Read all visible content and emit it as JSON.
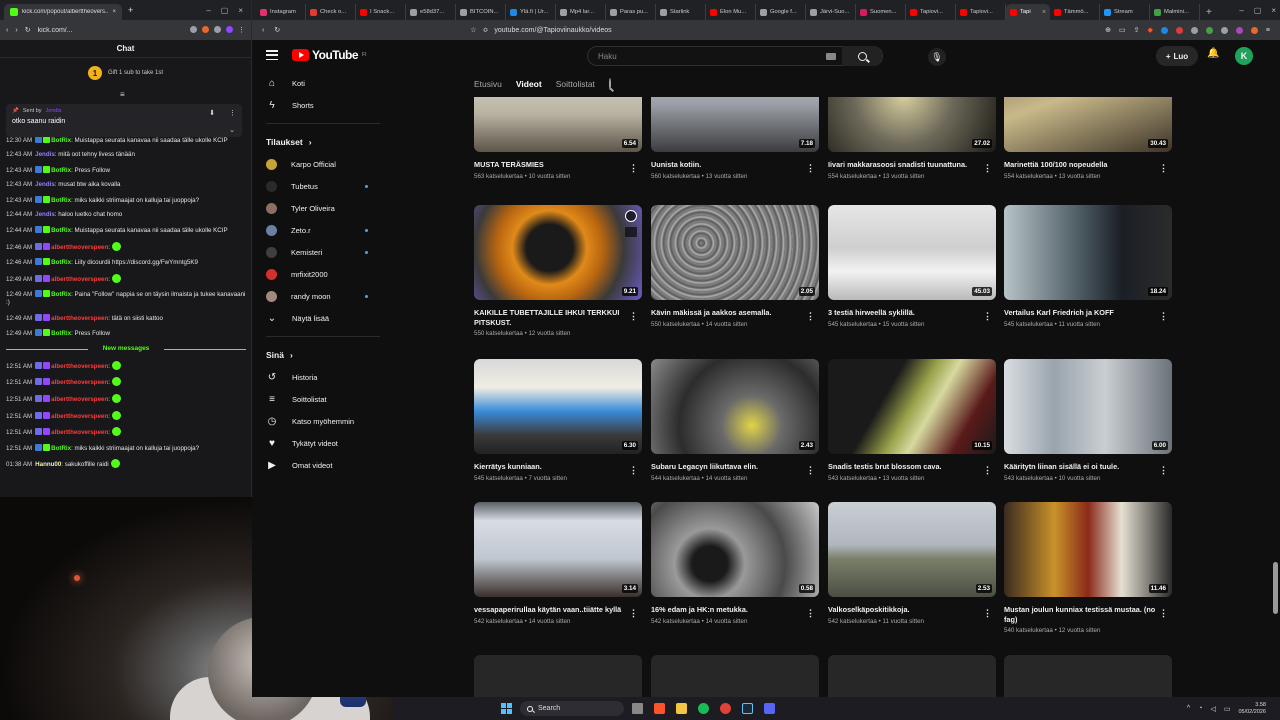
{
  "kick": {
    "tab_title": "kick.com/popout/alberttheovers...",
    "url": "kick.com/...",
    "chat_title": "Chat",
    "gift_text": "Gift 1 sub to take 1st",
    "gift_rank": "1",
    "pinned": {
      "sent_by_label": "Sent by",
      "sent_by_user": "Jendis",
      "message": "otko saanu raidin"
    },
    "new_messages_label": "New messages",
    "messages": [
      {
        "time": "12:30 AM",
        "badges": [
          "blue",
          "green"
        ],
        "user": "BotRix",
        "ucls": "u-botrix",
        "text": ": Muistappa seurata kanavaa nii saadaa tälle ukolle KCIP",
        "emote": false
      },
      {
        "time": "12:43 AM",
        "badges": [],
        "user": "Jendis",
        "ucls": "u-jendis",
        "text": ": mitä oot tehny livess tänään",
        "emote": false
      },
      {
        "time": "12:43 AM",
        "badges": [
          "blue",
          "green"
        ],
        "user": "BotRix",
        "ucls": "u-botrix",
        "text": ": Press Follow",
        "emote": false
      },
      {
        "time": "12:43 AM",
        "badges": [],
        "user": "Jendis",
        "ucls": "u-jendis",
        "text": ": musat btw aika kovalla",
        "emote": false
      },
      {
        "time": "12:43 AM",
        "badges": [
          "blue",
          "green"
        ],
        "user": "BotRix",
        "ucls": "u-botrix",
        "text": ": miks kaikki striimaajat on kalluja tai juoppoja?",
        "emote": false
      },
      {
        "time": "12:44 AM",
        "badges": [],
        "user": "Jendis",
        "ucls": "u-jendis",
        "text": ": haloo luetko chat homo",
        "emote": false
      },
      {
        "time": "12:44 AM",
        "badges": [
          "blue",
          "green"
        ],
        "user": "BotRix",
        "ucls": "u-botrix",
        "text": ": Muistappa seurata kanavaa nii saadaa tälle ukolle KCIP",
        "emote": false
      },
      {
        "time": "12:46 AM",
        "badges": [
          "mic",
          "purple"
        ],
        "user": "alberttheoverspeen",
        "ucls": "u-albert",
        "text": ":",
        "emote": true
      },
      {
        "time": "12:46 AM",
        "badges": [
          "blue",
          "green"
        ],
        "user": "BotRix",
        "ucls": "u-botrix",
        "text": ": Liity dicourdii https://discord.gg/FwYmntg5K9",
        "emote": false
      },
      {
        "time": "12:49 AM",
        "badges": [
          "mic",
          "purple"
        ],
        "user": "alberttheoverspeen",
        "ucls": "u-albert",
        "text": ":",
        "emote": true
      },
      {
        "time": "12:49 AM",
        "badges": [
          "blue",
          "green"
        ],
        "user": "BotRix",
        "ucls": "u-botrix",
        "text": ": Paina \"Follow\" nappia se on täysin ilmaista ja tukee kanavaani :)",
        "emote": false
      },
      {
        "time": "12:49 AM",
        "badges": [
          "mic",
          "purple"
        ],
        "user": "alberttheoverspeen",
        "ucls": "u-albert",
        "text": ": tätä on siisti kattoo",
        "emote": false
      },
      {
        "time": "12:49 AM",
        "badges": [
          "blue",
          "green"
        ],
        "user": "BotRix",
        "ucls": "u-botrix",
        "text": ": Press Follow",
        "emote": false
      }
    ],
    "new_messages": [
      {
        "time": "12:51 AM",
        "badges": [
          "mic",
          "purple"
        ],
        "user": "alberttheoverspeen",
        "ucls": "u-albert",
        "text": ":",
        "emote": true
      },
      {
        "time": "12:51 AM",
        "badges": [
          "mic",
          "purple"
        ],
        "user": "alberttheoverspeen",
        "ucls": "u-albert",
        "text": ":",
        "emote": true
      },
      {
        "time": "12:51 AM",
        "badges": [
          "mic",
          "purple"
        ],
        "user": "alberttheoverspeen",
        "ucls": "u-albert",
        "text": ":",
        "emote": true
      },
      {
        "time": "12:51 AM",
        "badges": [
          "mic",
          "purple"
        ],
        "user": "alberttheoverspeen",
        "ucls": "u-albert",
        "text": ":",
        "emote": true
      },
      {
        "time": "12:51 AM",
        "badges": [
          "mic",
          "purple"
        ],
        "user": "alberttheoverspeen",
        "ucls": "u-albert",
        "text": ":",
        "emote": true
      },
      {
        "time": "12:51 AM",
        "badges": [
          "blue",
          "green"
        ],
        "user": "BotRix",
        "ucls": "u-botrix",
        "text": ": miks kaikki striimaajat on kalluja tai juoppoja?",
        "emote": false
      },
      {
        "time": "01:38 AM",
        "badges": [],
        "user": "Hannu00",
        "ucls": "u-hannu",
        "text": ": sakukoffille raidi",
        "emote": true
      }
    ]
  },
  "browser": {
    "tabs": [
      {
        "label": "Instagram",
        "color": "#e1306c"
      },
      {
        "label": "Check o...",
        "color": "#e53935"
      },
      {
        "label": "I Snack...",
        "color": "#ff0000"
      },
      {
        "label": "e58d37...",
        "color": "#9aa0a6"
      },
      {
        "label": "BITCOIN...",
        "color": "#9aa0a6"
      },
      {
        "label": "Ylä.fi | Ur...",
        "color": "#1e88e5"
      },
      {
        "label": "Mp4 lar...",
        "color": "#9aa0a6"
      },
      {
        "label": "Paras pu...",
        "color": "#9aa0a6"
      },
      {
        "label": "Starlink",
        "color": "#9aa0a6"
      },
      {
        "label": "Elon Mu...",
        "color": "#ff0000"
      },
      {
        "label": "Google f...",
        "color": "#9aa0a6"
      },
      {
        "label": "Järvi-Suo...",
        "color": "#9aa0a6"
      },
      {
        "label": "Suomen...",
        "color": "#d81b60"
      },
      {
        "label": "Tapiovi...",
        "color": "#ff0000"
      },
      {
        "label": "Tapiovi...",
        "color": "#ff0000"
      }
    ],
    "active_tab": "Tapi",
    "after_tabs": [
      {
        "label": "Tämmö...",
        "color": "#ff0000"
      },
      {
        "label": "Stream",
        "color": "#2196f3"
      },
      {
        "label": "Malmini...",
        "color": "#43a047"
      }
    ],
    "url": "youtube.com/@Tapioviinaukko/videos"
  },
  "youtube": {
    "logo_text": "YouTube",
    "logo_region": "FI",
    "search_placeholder": "Haku",
    "create_label": "Luo",
    "avatar_letter": "K",
    "sidebar": {
      "main": [
        {
          "label": "Koti",
          "icon": "⌂",
          "name": "home-icon"
        },
        {
          "label": "Shorts",
          "icon": "ϟ",
          "name": "shorts-icon"
        }
      ],
      "subscriptions_title": "Tilaukset",
      "subscriptions": [
        {
          "label": "Karpo Official",
          "color": "#c7a13a",
          "live": false
        },
        {
          "label": "Tubetus",
          "color": "#2a2a2a",
          "live": true
        },
        {
          "label": "Tyler Oliveira",
          "color": "#8a6f63",
          "live": false
        },
        {
          "label": "Zeto.r",
          "color": "#6b7fa3",
          "live": true
        },
        {
          "label": "Kemisteri",
          "color": "#3f3f3f",
          "live": true
        },
        {
          "label": "mrfixit2000",
          "color": "#d32f2f",
          "live": false
        },
        {
          "label": "randy moon",
          "color": "#a18a7a",
          "live": true
        }
      ],
      "show_more": "Näytä lisää",
      "you_title": "Sinä",
      "you": [
        {
          "label": "Historia",
          "icon": "↺",
          "name": "history-icon"
        },
        {
          "label": "Soittolistat",
          "icon": "≡",
          "name": "playlists-icon"
        },
        {
          "label": "Katso myöhemmin",
          "icon": "◷",
          "name": "watch-later-icon"
        },
        {
          "label": "Tykätyt videot",
          "icon": "♥",
          "name": "liked-icon"
        },
        {
          "label": "Omat videot",
          "icon": "▶",
          "name": "your-videos-icon"
        }
      ]
    },
    "channel_tabs": [
      "Etusivu",
      "Videot",
      "Soittolistat"
    ],
    "active_channel_tab": 1,
    "videos": [
      {
        "title": "MUSTA TERÄSMIES",
        "views": "563 katselukertaa",
        "age": "10 vuotta sitten",
        "dur": "6.54",
        "bg": "linear-gradient(180deg,#e6e2d8 0%,#b8b2a2 60%,#5c5548 100%)"
      },
      {
        "title": "Uunista kotiin.",
        "views": "560 katselukertaa",
        "age": "13 vuotta sitten",
        "dur": "7.18",
        "bg": "linear-gradient(180deg,#c9ccd1 0%,#9a9ea6 50%,#3b3c3f 100%)"
      },
      {
        "title": "Iivari makkarasoosi snadisti tuunattuna.",
        "views": "554 katselukertaa",
        "age": "13 vuotta sitten",
        "dur": "27.02",
        "bg": "radial-gradient(circle at 45% 40%,#d9d0a0 0%,#6e6a5a 45%,#1c1a16 100%)"
      },
      {
        "title": "Marinettiä 100/100 nopeudella",
        "views": "554 katselukertaa",
        "age": "13 vuotta sitten",
        "dur": "30.43",
        "bg": "linear-gradient(160deg,#8a7455 0%,#c9b98a 40%,#3d3428 100%)"
      },
      {
        "title": "KAIKILLE TUBETTAJILLE IHKUI TERKKUI PITSKUST.",
        "views": "550 katselukertaa",
        "age": "12 vuotta sitten",
        "dur": "9.21",
        "clock": true,
        "bg": "radial-gradient(circle at 45% 45%,#1a1a1a 0%,#1a1a1a 22%,#e08a1a 35%,#b86510 50%,#3a3a3a 70%,#6a5cc4 100%)"
      },
      {
        "title": "Kävin mäkissä ja aakkos asemalla.",
        "views": "550 katselukertaa",
        "age": "14 vuotta sitten",
        "dur": "2.05",
        "bg": "repeating-radial-gradient(circle at 30% 40%,#8a8a8a 0px,#5a5a5a 3px,#b0b0b0 5px,#6a6a6a 7px)"
      },
      {
        "title": "3 testiä hirweellä syklillä.",
        "views": "545 katselukertaa",
        "age": "15 vuotta sitten",
        "dur": "45.03",
        "bg": "linear-gradient(180deg,#e6e6e6 0%,#cfcfcf 45%,#f2f2f2 70%,#b9b9b9 100%)"
      },
      {
        "title": "Vertailus Karl Friedrich ja KOFF",
        "views": "545 katselukertaa",
        "age": "11 vuotta sitten",
        "dur": "18.24",
        "bg": "linear-gradient(90deg,#b7c3c7 0%,#4d5b63 45%,#1b1f26 70%,#2b2b2b 100%)"
      },
      {
        "title": "Kierrätys kunniaan.",
        "views": "545 katselukertaa",
        "age": "7 vuotta sitten",
        "dur": "6.30",
        "bg": "linear-gradient(180deg,#d8d8d8 0%,#f0ede4 30%,#3a8bd9 55%,#3a3a3a 80%,#222 100%)"
      },
      {
        "title": "Subaru Legacyn liikuttava elin.",
        "views": "544 katselukertaa",
        "age": "14 vuotta sitten",
        "dur": "2.43",
        "bg": "radial-gradient(circle at 60% 70%,#e2d34a 0%,#6a6a6a 25%,#2c2c2c 60%,#8a8a8a 100%)"
      },
      {
        "title": "Snadis testis brut blossom cava.",
        "views": "543 katselukertaa",
        "age": "13 vuotta sitten",
        "dur": "10.15",
        "bg": "linear-gradient(120deg,#1a1a1a 0%,#1a1a1a 35%,#9aa24a 50%,#d7d9a0 60%,#5a1a1a 80%,#1a1a1a 100%)"
      },
      {
        "title": "Kääritytn liinan sisällä ei oi tuule.",
        "views": "543 katselukertaa",
        "age": "10 vuotta sitten",
        "dur": "6.00",
        "bg": "linear-gradient(90deg,#d9dde2 0%,#9aa4ad 30%,#c9ced2 60%,#6b727a 100%)"
      },
      {
        "title": "vessapaperirullaa käytän vaan..tiiätte kyllä",
        "views": "542 katselukertaa",
        "age": "14 vuotta sitten",
        "dur": "3.14",
        "bg": "linear-gradient(180deg,#5a5f66 0%,#d8dde4 20%,#bfc6cf 60%,#3a2f2a 100%)"
      },
      {
        "title": "16% edam ja HK:n metukka.",
        "views": "542 katselukertaa",
        "age": "14 vuotta sitten",
        "dur": "0.58",
        "bg": "radial-gradient(circle at 35% 65%,#1a1a1a 0%,#1a1a1a 14%,#9a9a9a 28%,#4a4a4a 60%,#c9c9c9 100%)"
      },
      {
        "title": "Valkoselkäposkitikkoja.",
        "views": "542 katselukertaa",
        "age": "11 vuotta sitten",
        "dur": "2.53",
        "bg": "linear-gradient(180deg,#c9cfd4 0%,#b0b7bd 45%,#7a7f6a 60%,#4a4f42 100%)"
      },
      {
        "title": "Mustan joulun kunniax testissä mustaa. (no fag)",
        "views": "540 katselukertaa",
        "age": "12 vuotta sitten",
        "dur": "11.46",
        "bg": "linear-gradient(90deg,#3a2a20 0%,#c9922a 30%,#8a2a1a 50%,#e6e0d2 70%,#2a2a2a 100%)"
      }
    ],
    "placeholder_count": 4
  },
  "taskbar": {
    "search_placeholder": "Search",
    "time": "3.58",
    "date": "05/02/2026"
  }
}
